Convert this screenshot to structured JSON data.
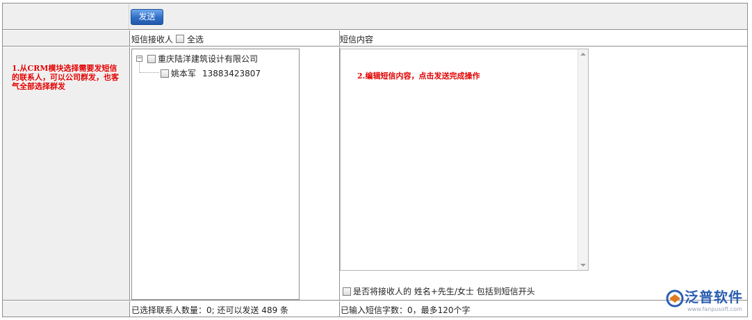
{
  "toolbar": {
    "send_label": "发送"
  },
  "recipients": {
    "header_label": "短信接收人",
    "select_all_label": "全选",
    "tree": {
      "company": "重庆陆洋建筑设计有限公司",
      "contacts": [
        {
          "name": "姚本军",
          "phone": "13883423807"
        }
      ]
    },
    "footer": "已选择联系人数量：0;  还可以发送 489 条"
  },
  "content": {
    "header_label": "短信内容",
    "include_name_label": "是否将接收人的 姓名+先生/女士 包括到短信开头",
    "footer": "已输入短信字数：0，最多120个字"
  },
  "annotations": {
    "step1": "1.从CRM模块选择需要发短信的联系人，可以公司群发，也客气全部选择群发",
    "step2": "2.编辑短信内容，点击发送完成操作"
  },
  "logo": {
    "brand": "泛普软件",
    "url": "www.fanpusoft.com"
  },
  "colors": {
    "annotation": "#e00000",
    "button": "#2f6dc6",
    "brand": "#2a5db0"
  }
}
